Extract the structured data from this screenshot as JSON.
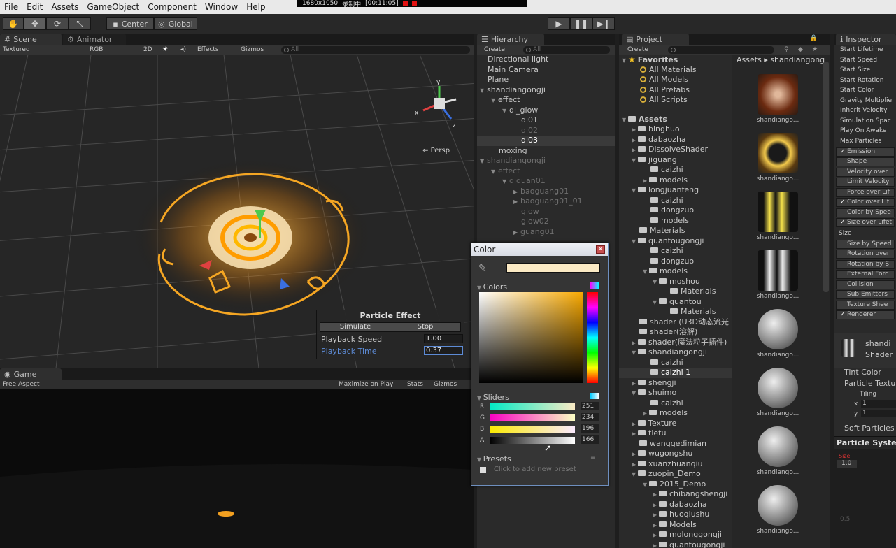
{
  "menu": [
    "File",
    "Edit",
    "Assets",
    "GameObject",
    "Component",
    "Window",
    "Help"
  ],
  "recorder": {
    "resolution": "1680x1050",
    "status": "录制中",
    "time": "[00:11:05]"
  },
  "toolbar": {
    "center": "Center",
    "global": "Global"
  },
  "scene": {
    "tab": "Scene",
    "tab2": "Animator",
    "render_mode": "Textured",
    "color_mode": "RGB",
    "mode_2d": "2D",
    "effects": "Effects",
    "gizmos": "Gizmos",
    "search_placeholder": "All",
    "persp": "Persp"
  },
  "particle_effect": {
    "title": "Particle Effect",
    "simulate": "Simulate",
    "stop": "Stop",
    "playback_speed_label": "Playback Speed",
    "playback_speed": "1.00",
    "playback_time_label": "Playback Time",
    "playback_time": "0.37"
  },
  "game": {
    "tab": "Game",
    "aspect": "Free Aspect",
    "maximize": "Maximize on Play",
    "stats": "Stats",
    "gizmos": "Gizmos"
  },
  "hierarchy": {
    "tab": "Hierarchy",
    "create": "Create",
    "search_placeholder": "All",
    "rows": [
      {
        "label": "Directional light"
      },
      {
        "label": "Main Camera"
      },
      {
        "label": "Plane"
      },
      {
        "label": "shandiangongji"
      },
      {
        "label": "effect"
      },
      {
        "label": "di_glow"
      },
      {
        "label": "di01"
      },
      {
        "label": "di02"
      },
      {
        "label": "di03"
      },
      {
        "label": "moxing"
      },
      {
        "label": "shandiangongji"
      },
      {
        "label": "effect"
      },
      {
        "label": "diquan01"
      },
      {
        "label": "baoguang01"
      },
      {
        "label": "baoguang01_01"
      },
      {
        "label": "glow"
      },
      {
        "label": "glow02"
      },
      {
        "label": "guang01"
      }
    ]
  },
  "project": {
    "tab": "Project",
    "create": "Create",
    "favorites": "Favorites",
    "fav_items": [
      "All Materials",
      "All Models",
      "All Prefabs",
      "All Scripts"
    ],
    "assets": "Assets",
    "tree": [
      {
        "label": "binghuo"
      },
      {
        "label": "dabaozha"
      },
      {
        "label": "DissolveShader"
      },
      {
        "label": "jiguang"
      },
      {
        "label": "caizhi"
      },
      {
        "label": "models"
      },
      {
        "label": "longjuanfeng"
      },
      {
        "label": "caizhi"
      },
      {
        "label": "dongzuo"
      },
      {
        "label": "models"
      },
      {
        "label": "Materials"
      },
      {
        "label": "quantougongji"
      },
      {
        "label": "caizhi"
      },
      {
        "label": "dongzuo"
      },
      {
        "label": "models"
      },
      {
        "label": "moshou"
      },
      {
        "label": "Materials"
      },
      {
        "label": "quantou"
      },
      {
        "label": "Materials"
      },
      {
        "label": "shader (U3D动态流光"
      },
      {
        "label": "shader(溶解)"
      },
      {
        "label": "shader(魔法粒子插件)"
      },
      {
        "label": "shandiangongji"
      },
      {
        "label": "caizhi"
      },
      {
        "label": "caizhi 1"
      },
      {
        "label": "shengji"
      },
      {
        "label": "shuimo"
      },
      {
        "label": "caizhi"
      },
      {
        "label": "models"
      },
      {
        "label": "Texture"
      },
      {
        "label": "tietu"
      },
      {
        "label": "wanggedimian"
      },
      {
        "label": "wugongshu"
      },
      {
        "label": "xuanzhuanqiu"
      },
      {
        "label": "zuopin_Demo"
      },
      {
        "label": "2015_Demo"
      },
      {
        "label": "chibangshengji"
      },
      {
        "label": "dabaozha"
      },
      {
        "label": "huoqiushu"
      },
      {
        "label": "Models"
      },
      {
        "label": "molonggongji"
      },
      {
        "label": "quantougongji"
      }
    ],
    "breadcrumb_root": "Assets",
    "breadcrumb_leaf": "shandiangong",
    "asset_caption": "shandiango..."
  },
  "inspector": {
    "tab": "Inspector",
    "props": [
      "Start Lifetime",
      "Start Speed",
      "Start Size",
      "Start Rotation",
      "Start Color",
      "Gravity Multiplie",
      "Inherit Velocity",
      "Simulation Spac",
      "Play On Awake",
      "Max Particles"
    ],
    "modules": [
      {
        "label": "Emission",
        "on": true
      },
      {
        "label": "Shape",
        "on": false
      },
      {
        "label": "Velocity over",
        "on": false
      },
      {
        "label": "Limit Velocity",
        "on": false
      },
      {
        "label": "Force over Lif",
        "on": false
      },
      {
        "label": "Color over Lif",
        "on": true
      },
      {
        "label": "Color by Spee",
        "on": false
      },
      {
        "label": "Size over Lifet",
        "on": true
      }
    ],
    "size_label": "Size",
    "modules2": [
      {
        "label": "Size by Speed",
        "on": false
      },
      {
        "label": "Rotation over",
        "on": false
      },
      {
        "label": "Rotation by S",
        "on": false
      },
      {
        "label": "External Forc",
        "on": false
      },
      {
        "label": "Collision",
        "on": false
      },
      {
        "label": "Sub Emitters",
        "on": false
      },
      {
        "label": "Texture Shee",
        "on": false
      },
      {
        "label": "Renderer",
        "on": true
      }
    ],
    "material_name": "shandi",
    "shader_label": "Shader",
    "tint_color": "Tint Color",
    "particle_texture": "Particle Textu",
    "tiling": "Tiling",
    "x_label": "x",
    "x_val": "1",
    "y_label": "y",
    "y_val": "1",
    "soft_particles": "Soft Particles",
    "particle_system": "Particle Syste",
    "curve_label": "Size",
    "curve_top": "1.0",
    "curve_mid": "0.5"
  },
  "color_picker": {
    "title": "Color",
    "close": "✕",
    "colors_label": "Colors",
    "sliders_label": "Sliders",
    "r_label": "R",
    "r": 251,
    "g_label": "G",
    "g": 234,
    "b_label": "B",
    "b": 196,
    "a_label": "A",
    "a": 166,
    "presets_label": "Presets",
    "add_preset": "Click to add new preset",
    "swatch_color": "#fbeac4"
  }
}
